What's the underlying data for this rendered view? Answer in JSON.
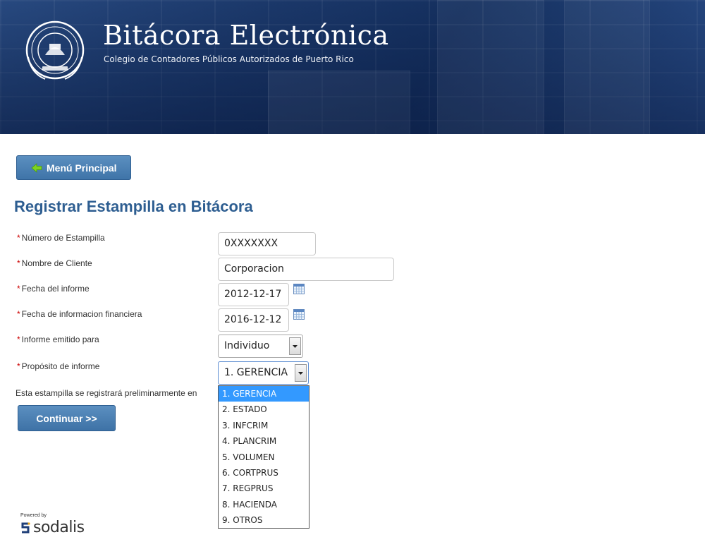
{
  "header": {
    "title": "Bitácora Electrónica",
    "subtitle": "Colegio de Contadores Públicos Autorizados de Puerto Rico",
    "logo_icon": "seal-logo"
  },
  "nav": {
    "menu_button_label": "Menú Principal",
    "menu_button_icon": "arrow-left-icon"
  },
  "page": {
    "title": "Registrar Estampilla en Bitácora"
  },
  "form": {
    "required_marker": "*",
    "fields": [
      {
        "label": "Número de Estampilla",
        "value": "0XXXXXXX"
      },
      {
        "label": "Nombre de Cliente",
        "value": "Corporacion"
      },
      {
        "label": "Fecha del informe",
        "value": "2012-12-17"
      },
      {
        "label": "Fecha de informacion financiera",
        "value": "2016-12-12"
      },
      {
        "label": "Informe emitido para",
        "value": "Individuo"
      },
      {
        "label": "Propósito de informe",
        "value": "1. GERENCIA"
      }
    ],
    "proposito_options": [
      "1. GERENCIA",
      "2. ESTADO",
      "3. INFCRIM",
      "4. PLANCRIM",
      "5. VOLUMEN",
      "6. CORTPRUS",
      "7. REGPRUS",
      "8. HACIENDA",
      "9. OTROS"
    ],
    "selected_option_index": 0,
    "note": "Esta estampilla se registrará preliminarmente en",
    "continue_label": "Continuar >>"
  },
  "footer": {
    "powered_by": "Powered by",
    "brand": "sodalis"
  },
  "colors": {
    "accent": "#3f74a8",
    "title": "#2e5e91",
    "required": "#cc0000",
    "selected_option": "#3399ff"
  }
}
